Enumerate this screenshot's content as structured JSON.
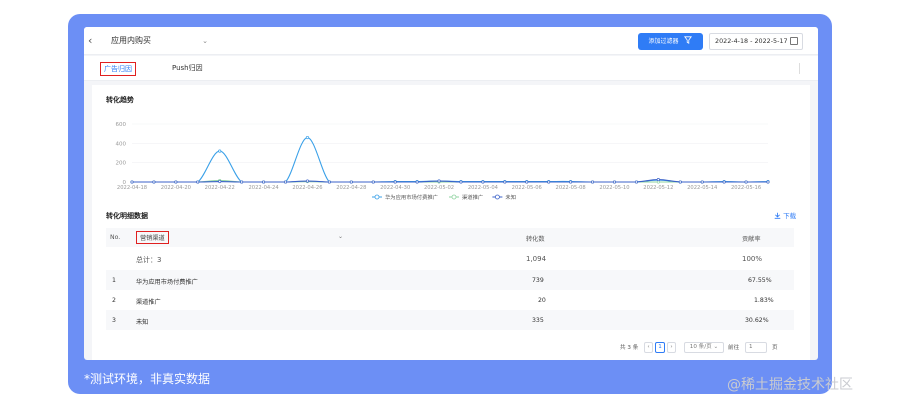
{
  "header": {
    "back_glyph": "‹",
    "page_select_value": "应用内购买",
    "add_filter_label": "添加过滤器",
    "date_range": "2022-4-18 - 2022-5-17"
  },
  "tabs": [
    {
      "label": "广告归因",
      "active": true
    },
    {
      "label": "Push归因",
      "active": false
    }
  ],
  "trend": {
    "title": "转化趋势"
  },
  "chart_data": {
    "type": "line",
    "x": [
      "2022-04-18",
      "2022-04-19",
      "2022-04-20",
      "2022-04-21",
      "2022-04-22",
      "2022-04-23",
      "2022-04-24",
      "2022-04-25",
      "2022-04-26",
      "2022-04-27",
      "2022-04-28",
      "2022-04-29",
      "2022-04-30",
      "2022-05-01",
      "2022-05-02",
      "2022-05-03",
      "2022-05-04",
      "2022-05-05",
      "2022-05-06",
      "2022-05-07",
      "2022-05-08",
      "2022-05-09",
      "2022-05-10",
      "2022-05-11",
      "2022-05-12",
      "2022-05-13",
      "2022-05-14",
      "2022-05-15",
      "2022-05-16",
      "2022-05-17"
    ],
    "x_tick_labels": [
      "2022-04-18",
      "2022-04-20",
      "2022-04-22",
      "2022-04-24",
      "2022-04-26",
      "2022-04-28",
      "2022-04-30",
      "2022-05-02",
      "2022-05-04",
      "2022-05-06",
      "2022-05-08",
      "2022-05-10",
      "2022-05-12",
      "2022-05-14",
      "2022-05-16"
    ],
    "y_ticks": [
      0,
      200,
      400,
      600
    ],
    "ylim": [
      0,
      600
    ],
    "series": [
      {
        "name": "华为应用市场付费推广",
        "color": "#3aa0e8",
        "values": [
          0,
          0,
          0,
          0,
          320,
          0,
          0,
          0,
          460,
          0,
          0,
          0,
          5,
          5,
          10,
          5,
          5,
          5,
          5,
          5,
          5,
          0,
          0,
          0,
          20,
          0,
          0,
          5,
          0,
          5
        ]
      },
      {
        "name": "渠道推广",
        "color": "#8fd3a0",
        "values": [
          0,
          0,
          0,
          0,
          15,
          0,
          0,
          0,
          5,
          0,
          0,
          0,
          0,
          0,
          0,
          0,
          0,
          0,
          0,
          0,
          0,
          0,
          0,
          0,
          0,
          0,
          0,
          0,
          0,
          0
        ]
      },
      {
        "name": "未知",
        "color": "#3b62c9",
        "values": [
          0,
          0,
          0,
          0,
          5,
          0,
          0,
          0,
          10,
          0,
          0,
          0,
          0,
          0,
          10,
          0,
          0,
          0,
          0,
          0,
          0,
          0,
          0,
          0,
          25,
          0,
          0,
          0,
          0,
          0
        ]
      }
    ],
    "legend_position": "bottom"
  },
  "detail": {
    "title": "转化明细数据",
    "download_label": "下载",
    "columns": {
      "no": "No.",
      "channel": "营销渠道",
      "conversions": "转化数",
      "contribution": "贡献率"
    },
    "total": {
      "label": "总计：3",
      "conversions": "1,094",
      "contribution": "100%"
    },
    "rows": [
      {
        "no": "1",
        "channel": "华为应用市场付费推广",
        "conversions": "739",
        "contribution": "67.55%"
      },
      {
        "no": "2",
        "channel": "渠道推广",
        "conversions": "20",
        "contribution": "1.83%"
      },
      {
        "no": "3",
        "channel": "未知",
        "conversions": "335",
        "contribution": "30.62%"
      }
    ]
  },
  "pagination": {
    "total_text": "共 3 条",
    "prev": "‹",
    "current_page": "1",
    "next": "›",
    "page_size": "10 条/页",
    "goto_label": "前往",
    "goto_value": "1",
    "page_unit": "页"
  },
  "footer_note": "*测试环境，非真实数据",
  "watermark": "@稀土掘金技术社区"
}
